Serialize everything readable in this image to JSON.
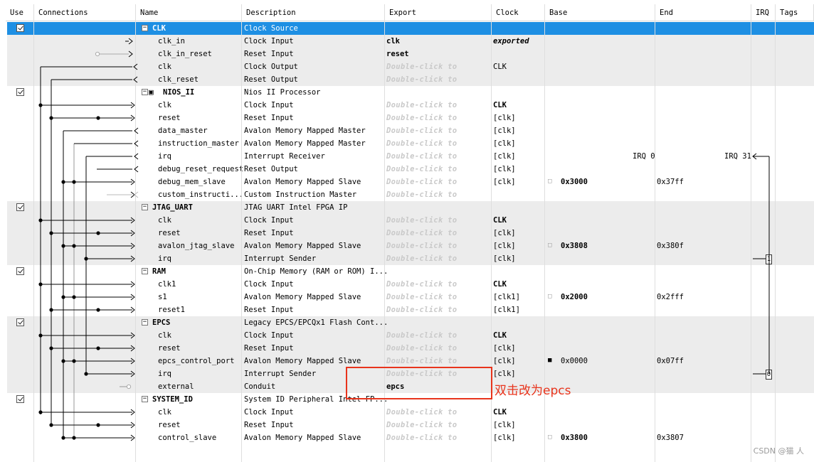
{
  "headers": [
    "Use",
    "Connections",
    "Name",
    "Description",
    "Export",
    "Clock",
    "Base",
    "End",
    "IRQ",
    "Tags"
  ],
  "double_click_text": "Double-click to",
  "rows": [
    {
      "kind": "comp",
      "use": true,
      "name": "CLK",
      "desc": "Clock Source",
      "export": "",
      "clock": "",
      "base": "",
      "end": "",
      "selected": true
    },
    {
      "kind": "port",
      "name": "clk_in",
      "desc": "Clock Input",
      "export": "clk",
      "export_style": "bold",
      "clock": "exported",
      "clock_style": "exported"
    },
    {
      "kind": "port",
      "name": "clk_in_reset",
      "desc": "Reset Input",
      "export": "reset",
      "export_style": "bold",
      "clock": ""
    },
    {
      "kind": "port",
      "name": "clk",
      "desc": "Clock Output",
      "export": "",
      "clock": "CLK"
    },
    {
      "kind": "port",
      "name": "clk_reset",
      "desc": "Reset Output",
      "export": "",
      "clock": ""
    },
    {
      "kind": "comp",
      "use": true,
      "name": "NIOS_II",
      "desc": "Nios II Processor",
      "cpu_icon": true
    },
    {
      "kind": "port",
      "name": "clk",
      "desc": "Clock Input",
      "export": "",
      "clock": "CLK",
      "clock_style": "bold"
    },
    {
      "kind": "port",
      "name": "reset",
      "desc": "Reset Input",
      "export": "",
      "clock": "[clk]"
    },
    {
      "kind": "port",
      "name": "data_master",
      "desc": "Avalon Memory Mapped Master",
      "export": "",
      "clock": "[clk]"
    },
    {
      "kind": "port",
      "name": "instruction_master",
      "desc": "Avalon Memory Mapped Master",
      "export": "",
      "clock": "[clk]"
    },
    {
      "kind": "port",
      "name": "irq",
      "desc": "Interrupt Receiver",
      "export": "",
      "clock": "[clk]",
      "irq_left": "IRQ 0",
      "irq_right": "IRQ 31"
    },
    {
      "kind": "port",
      "name": "debug_reset_request",
      "desc": "Reset Output",
      "export": "",
      "clock": "[clk]"
    },
    {
      "kind": "port",
      "name": "debug_mem_slave",
      "desc": "Avalon Memory Mapped Slave",
      "export": "",
      "clock": "[clk]",
      "base": "0x3000",
      "end": "0x37ff",
      "lock": "gray"
    },
    {
      "kind": "port",
      "name": "custom_instructi...",
      "desc": "Custom Instruction Master",
      "export": "",
      "clock": ""
    },
    {
      "kind": "comp",
      "use": true,
      "name": "JTAG_UART",
      "desc": "JTAG UART Intel FPGA IP"
    },
    {
      "kind": "port",
      "name": "clk",
      "desc": "Clock Input",
      "export": "",
      "clock": "CLK",
      "clock_style": "bold"
    },
    {
      "kind": "port",
      "name": "reset",
      "desc": "Reset Input",
      "export": "",
      "clock": "[clk]"
    },
    {
      "kind": "port",
      "name": "avalon_jtag_slave",
      "desc": "Avalon Memory Mapped Slave",
      "export": "",
      "clock": "[clk]",
      "base": "0x3808",
      "end": "0x380f",
      "lock": "gray"
    },
    {
      "kind": "port",
      "name": "irq",
      "desc": "Interrupt Sender",
      "export": "",
      "clock": "[clk]",
      "irq_num": "1"
    },
    {
      "kind": "comp",
      "use": true,
      "name": "RAM",
      "desc": "On-Chip Memory (RAM or ROM) I..."
    },
    {
      "kind": "port",
      "name": "clk1",
      "desc": "Clock Input",
      "export": "",
      "clock": "CLK",
      "clock_style": "bold"
    },
    {
      "kind": "port",
      "name": "s1",
      "desc": "Avalon Memory Mapped Slave",
      "export": "",
      "clock": "[clk1]",
      "base": "0x2000",
      "end": "0x2fff",
      "lock": "gray"
    },
    {
      "kind": "port",
      "name": "reset1",
      "desc": "Reset Input",
      "export": "",
      "clock": "[clk1]"
    },
    {
      "kind": "comp",
      "use": true,
      "name": "EPCS",
      "desc": "Legacy EPCS/EPCQx1 Flash Cont..."
    },
    {
      "kind": "port",
      "name": "clk",
      "desc": "Clock Input",
      "export": "",
      "clock": "CLK",
      "clock_style": "bold"
    },
    {
      "kind": "port",
      "name": "reset",
      "desc": "Reset Input",
      "export": "",
      "clock": "[clk]"
    },
    {
      "kind": "port",
      "name": "epcs_control_port",
      "desc": "Avalon Memory Mapped Slave",
      "export": "",
      "clock": "[clk]",
      "base": "0x0000",
      "end": "0x07ff",
      "lock": "dark",
      "base_style": "normal"
    },
    {
      "kind": "port",
      "name": "irq",
      "desc": "Interrupt Sender",
      "export": "",
      "clock": "[clk]",
      "irq_num": "0"
    },
    {
      "kind": "port",
      "name": "external",
      "desc": "Conduit",
      "export": "epcs",
      "export_style": "bold",
      "clock": ""
    },
    {
      "kind": "comp",
      "use": true,
      "name": "SYSTEM_ID",
      "desc": "System ID Peripheral Intel FP..."
    },
    {
      "kind": "port",
      "name": "clk",
      "desc": "Clock Input",
      "export": "",
      "clock": "CLK",
      "clock_style": "bold"
    },
    {
      "kind": "port",
      "name": "reset",
      "desc": "Reset Input",
      "export": "",
      "clock": "[clk]"
    },
    {
      "kind": "port",
      "name": "control_slave",
      "desc": "Avalon Memory Mapped Slave",
      "export": "",
      "clock": "[clk]",
      "base": "0x3800",
      "end": "0x3807",
      "lock": "gray"
    }
  ],
  "annotation": "双击改为epcs",
  "watermark": "CSDN @猫 人",
  "colors": {
    "selection": "#1e8fe3",
    "annotation": "#e8341c",
    "band_gray": "#ececec"
  }
}
